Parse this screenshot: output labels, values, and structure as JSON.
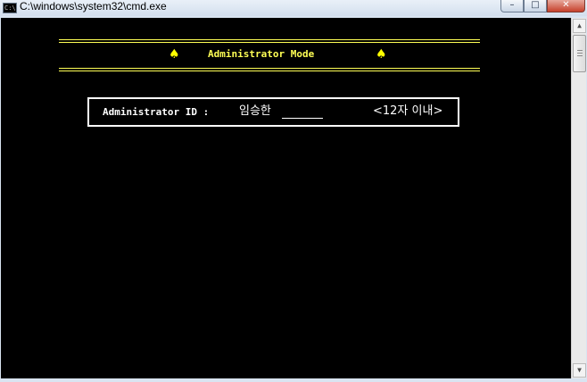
{
  "window": {
    "title": "C:\\windows\\system32\\cmd.exe",
    "icon_text": "C:\\",
    "minimize_glyph": "–",
    "maximize_glyph": "□",
    "close_glyph": "✕"
  },
  "header": {
    "spade_glyph": "♠",
    "title": "Administrator Mode"
  },
  "login": {
    "label": "Administrator ID :",
    "value": "임승한",
    "limit_note": "<12자 이내>"
  },
  "scrollbar": {
    "up_glyph": "▲",
    "down_glyph": "▼"
  },
  "colors": {
    "console_background": "#000000",
    "accent_yellow": "#ffff55",
    "text_white": "#ffffff"
  }
}
